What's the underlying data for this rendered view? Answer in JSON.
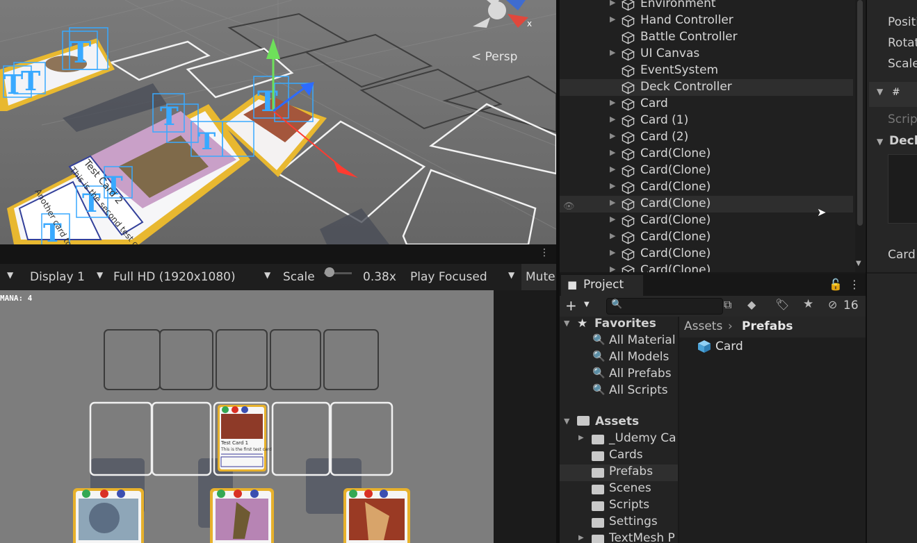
{
  "scene": {
    "persp_label": "Persp",
    "gizmo_axis": "x",
    "card_texts": [
      "Test Card 2",
      "This is the second test card",
      "Another card to test"
    ]
  },
  "game_toolbar": {
    "display": "Display 1",
    "resolution": "Full HD (1920x1080)",
    "scale_label": "Scale",
    "scale_value": "0.38x",
    "play_mode": "Play Focused",
    "mute": "Mute"
  },
  "game": {
    "mana": "MANA: 4",
    "mini_card_title": "Test Card 1",
    "mini_card_desc": "This is the first test card"
  },
  "hierarchy": {
    "items": [
      {
        "label": "Environment",
        "fold": true
      },
      {
        "label": "Hand Controller",
        "fold": true
      },
      {
        "label": "Battle Controller",
        "fold": false
      },
      {
        "label": "UI Canvas",
        "fold": true
      },
      {
        "label": "EventSystem",
        "fold": false
      },
      {
        "label": "Deck Controller",
        "fold": false
      },
      {
        "label": "Card",
        "fold": true
      },
      {
        "label": "Card (1)",
        "fold": true
      },
      {
        "label": "Card (2)",
        "fold": true
      },
      {
        "label": "Card(Clone)",
        "fold": true
      },
      {
        "label": "Card(Clone)",
        "fold": true
      },
      {
        "label": "Card(Clone)",
        "fold": true
      },
      {
        "label": "Card(Clone)",
        "fold": true
      },
      {
        "label": "Card(Clone)",
        "fold": true
      },
      {
        "label": "Card(Clone)",
        "fold": true
      },
      {
        "label": "Card(Clone)",
        "fold": true
      },
      {
        "label": "Card(Clone)",
        "fold": true
      }
    ]
  },
  "project": {
    "tab_label": "Project",
    "hidden_count": "16",
    "favorites_label": "Favorites",
    "favorites": [
      "All Material",
      "All Models",
      "All Prefabs",
      "All Scripts"
    ],
    "assets_label": "Assets",
    "folders": [
      "_Udemy Ca",
      "Cards",
      "Prefabs",
      "Scenes",
      "Scripts",
      "Settings",
      "TextMesh P"
    ],
    "breadcrumb_root": "Assets",
    "breadcrumb_current": "Prefabs",
    "content_items": [
      "Card"
    ]
  },
  "inspector": {
    "position": "Positi",
    "rotation": "Rotat",
    "scale": "Scale",
    "script": "Script",
    "deck": "Deck",
    "card": "Card"
  }
}
